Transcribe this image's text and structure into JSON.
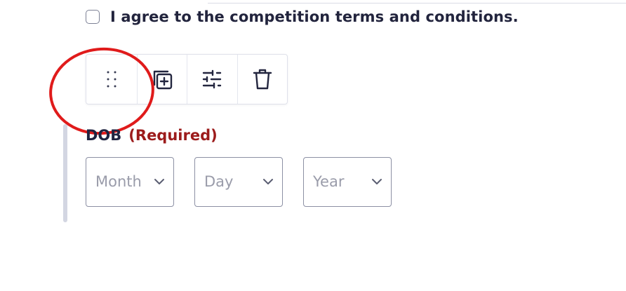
{
  "consent": {
    "label": "I agree to the competition terms and conditions.",
    "checked": false
  },
  "toolbar": {
    "tools": [
      {
        "name": "drag-handle",
        "icon": "drag-handle-icon"
      },
      {
        "name": "duplicate",
        "icon": "duplicate-icon"
      },
      {
        "name": "settings",
        "icon": "sliders-icon"
      },
      {
        "name": "delete",
        "icon": "trash-icon"
      }
    ]
  },
  "annotation": {
    "shape": "circle",
    "color": "#e01b1b",
    "target": "drag-handle"
  },
  "dob_field": {
    "label": "DOB",
    "required_text": "(Required)",
    "selects": [
      {
        "placeholder": "Month"
      },
      {
        "placeholder": "Day"
      },
      {
        "placeholder": "Year"
      }
    ]
  },
  "colors": {
    "text": "#1f2340",
    "required": "#9c1b1b",
    "border": "#8c90a4",
    "placeholder": "#9a9caa"
  }
}
